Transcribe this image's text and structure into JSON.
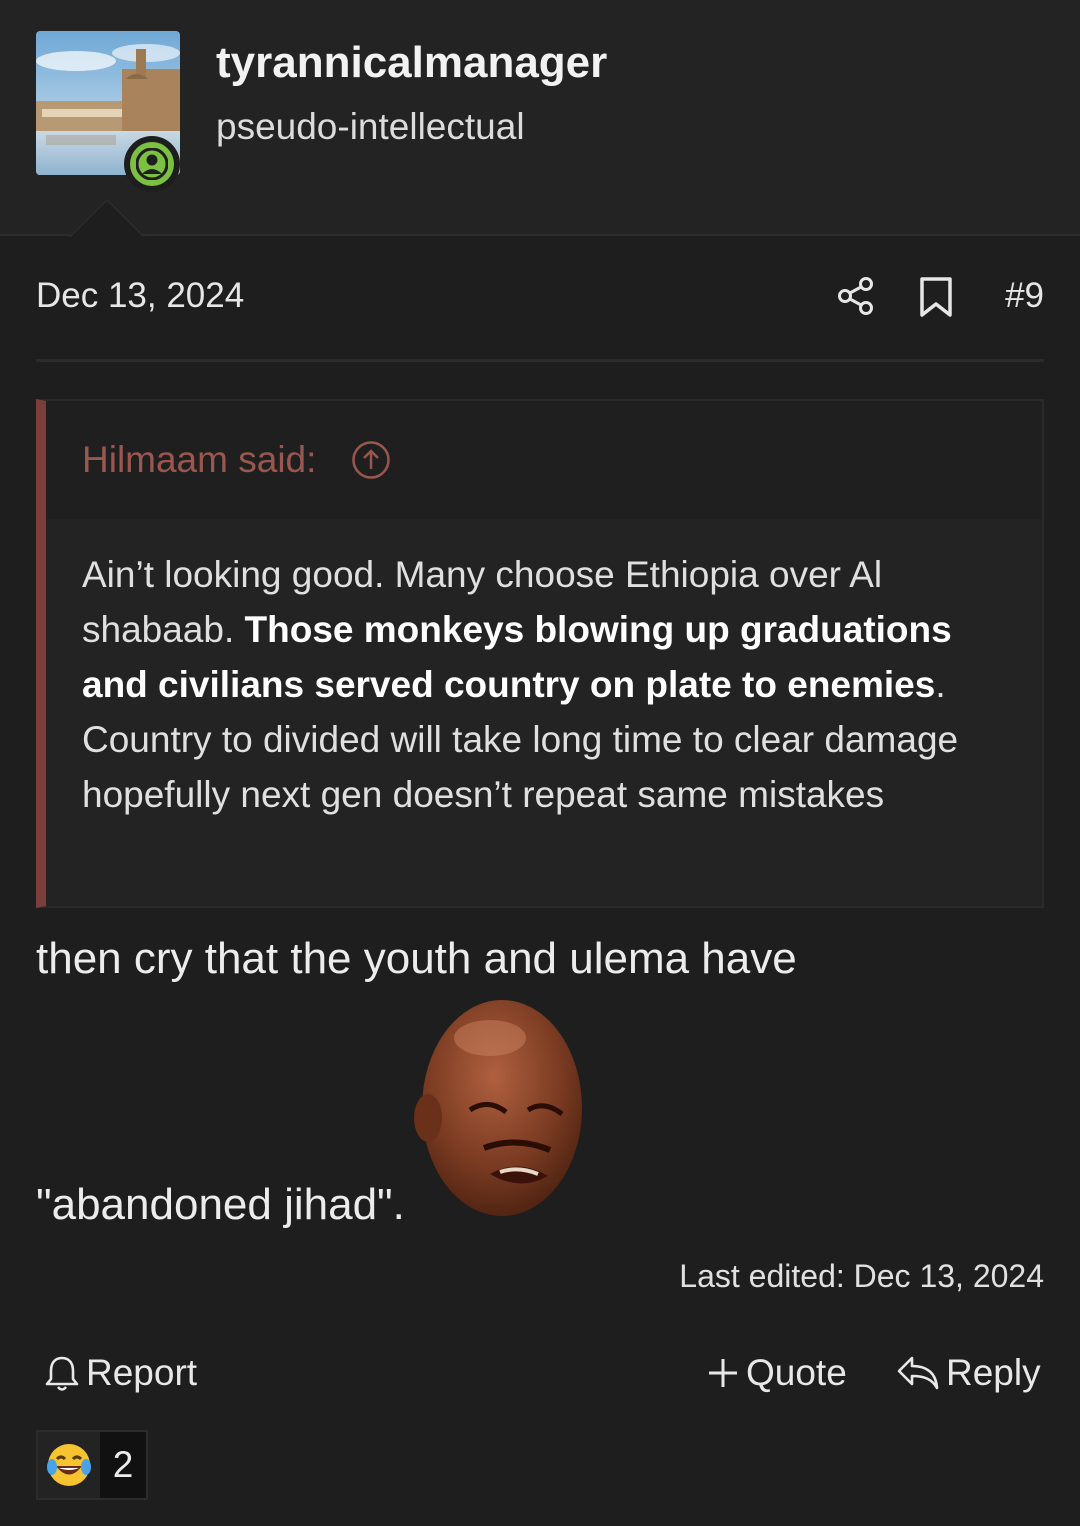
{
  "user": {
    "name": "tyrannicalmanager",
    "title": "pseudo-intellectual"
  },
  "post": {
    "date": "Dec 13, 2024",
    "number": "#9",
    "line1": "then cry that the youth and ulema have",
    "line2": "\"abandoned jihad\".",
    "edited": "Last edited: Dec 13, 2024"
  },
  "quote": {
    "author_label": "Hilmaam said:",
    "segments": [
      {
        "text": "Ain’t looking good. Many choose Ethiopia over Al shabaab. ",
        "bold": false
      },
      {
        "text": "Those monkeys blowing up graduations and civilians served country on plate to enemies",
        "bold": true
      },
      {
        "text": ".",
        "bold": false
      },
      {
        "text": "Country to divided will take long time to clear damage hopefully next gen doesn’t repeat same mistakes",
        "bold": false
      }
    ]
  },
  "actions": {
    "report": "Report",
    "quote": "Quote",
    "reply": "Reply"
  },
  "reactions": {
    "count": "2",
    "icon": "laughing-crying-emoji"
  },
  "colors": {
    "background": "#1e1e1e",
    "quote_accent": "#7a3f3b",
    "quote_author": "#9a5750",
    "online_status": "#7bc043"
  }
}
